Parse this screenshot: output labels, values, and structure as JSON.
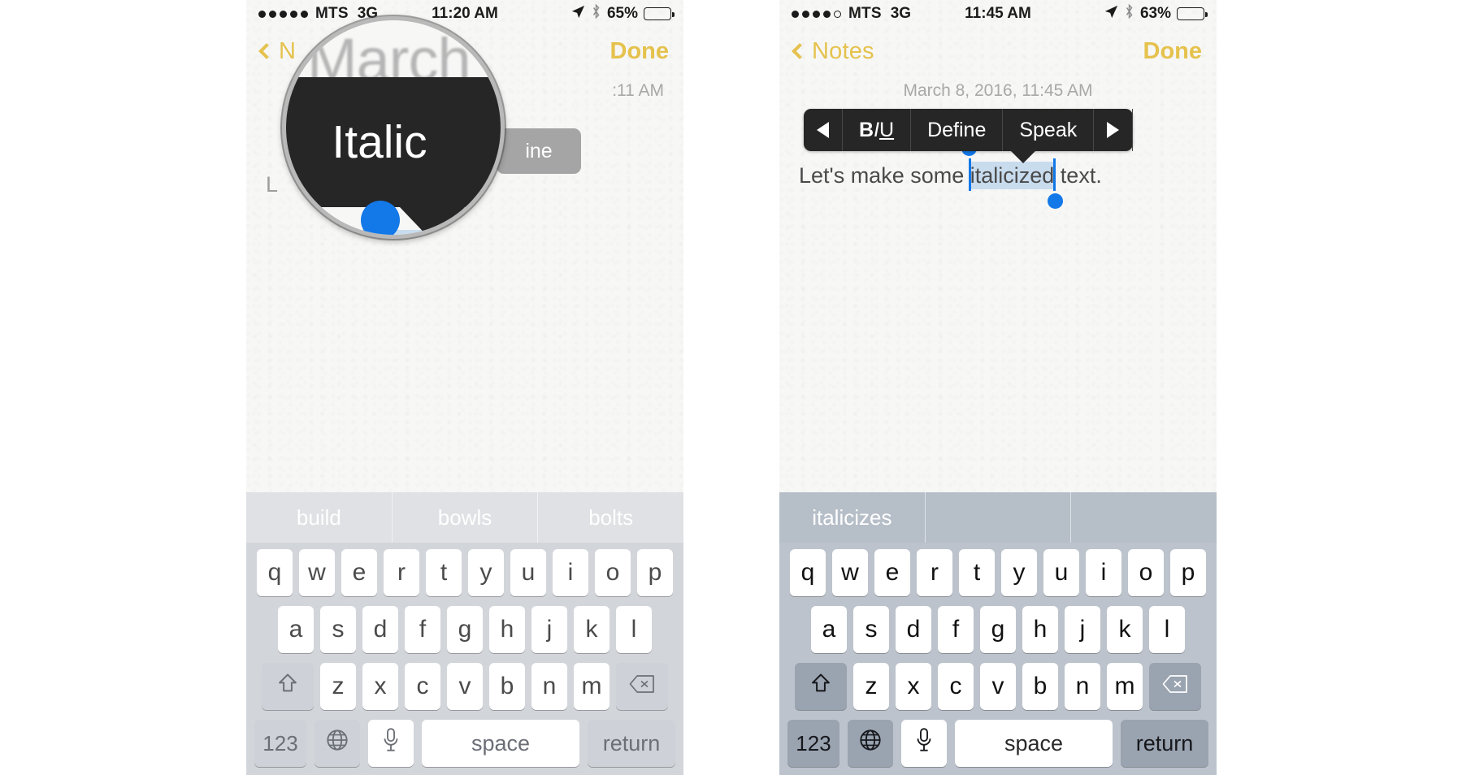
{
  "left_phone": {
    "status": {
      "signal_dots": [
        "filled",
        "filled",
        "filled",
        "filled",
        "filled"
      ],
      "carrier": "MTS",
      "network": "3G",
      "time": "11:20 AM",
      "battery_percent": "65%",
      "battery_level": 65,
      "location_icon": "location-arrow-icon",
      "bluetooth_icon": "bluetooth-icon"
    },
    "nav": {
      "back_label": "N",
      "back_label_full": "Notes",
      "done_label": "Done"
    },
    "note": {
      "date_partial": ":11 AM",
      "body_partial": "L"
    },
    "pill_button": {
      "label": "ine",
      "full_label": "Define"
    },
    "loupe": {
      "background_text": "March 8",
      "callout_label": "Italic",
      "magnifier_icon": "magnifier-loupe",
      "selection_knob_icon": "selection-handle-dot"
    },
    "keyboard": {
      "suggestions": [
        "build",
        "bowls",
        "bolts"
      ],
      "rows": [
        [
          "q",
          "w",
          "e",
          "r",
          "t",
          "y",
          "u",
          "i",
          "o",
          "p"
        ],
        [
          "a",
          "s",
          "d",
          "f",
          "g",
          "h",
          "j",
          "k",
          "l"
        ],
        [
          "z",
          "x",
          "c",
          "v",
          "b",
          "n",
          "m"
        ]
      ],
      "shift_icon": "shift-arrow-icon",
      "delete_icon": "backspace-delete-icon",
      "numbers_key": "123",
      "globe_icon": "globe-language-icon",
      "mic_icon": "microphone-icon",
      "space_key": "space",
      "return_key": "return"
    },
    "colors": {
      "accent": "#e5c24d",
      "selection_blue": "#1378e8",
      "selection_fill": "#c8dcee",
      "callout_black": "#262626",
      "keyboard_bg": "#d2d5da",
      "suggestbar_bg": "#dfe1e4",
      "key_white": "#ffffff",
      "key_grey": "#ced2d8"
    }
  },
  "right_phone": {
    "status": {
      "signal_dots": [
        "filled",
        "filled",
        "filled",
        "filled",
        "hollow"
      ],
      "carrier": "MTS",
      "network": "3G",
      "time": "11:45 AM",
      "battery_percent": "63%",
      "battery_level": 63,
      "location_icon": "location-arrow-icon",
      "bluetooth_icon": "bluetooth-icon"
    },
    "nav": {
      "back_label": "Notes",
      "done_label": "Done"
    },
    "note": {
      "date": "March 8, 2016, 11:45 AM",
      "body_before": "Let's make some ",
      "body_selected": "italicized",
      "body_after": " text."
    },
    "edit_callout": {
      "prev_arrow_icon": "triangle-left-icon",
      "format_label": "BIU",
      "format_bold": "B",
      "format_italic": "I",
      "format_underline": "U",
      "define_label": "Define",
      "speak_label": "Speak",
      "next_arrow_icon": "triangle-right-icon"
    },
    "keyboard": {
      "suggestions": [
        "italicizes",
        "",
        ""
      ],
      "rows": [
        [
          "q",
          "w",
          "e",
          "r",
          "t",
          "y",
          "u",
          "i",
          "o",
          "p"
        ],
        [
          "a",
          "s",
          "d",
          "f",
          "g",
          "h",
          "j",
          "k",
          "l"
        ],
        [
          "z",
          "x",
          "c",
          "v",
          "b",
          "n",
          "m"
        ]
      ],
      "shift_icon": "shift-arrow-icon",
      "delete_icon": "backspace-delete-icon",
      "numbers_key": "123",
      "globe_icon": "globe-language-icon",
      "mic_icon": "microphone-icon",
      "space_key": "space",
      "return_key": "return"
    },
    "colors": {
      "accent": "#e5b93c",
      "selection_blue": "#1378e8",
      "selection_fill": "#c8dcee",
      "callout_black": "#262626",
      "keyboard_bg": "#bcc3cc",
      "suggestbar_bg": "#b6bec8",
      "key_white": "#ffffff",
      "key_grey": "#9aa3b0"
    }
  }
}
